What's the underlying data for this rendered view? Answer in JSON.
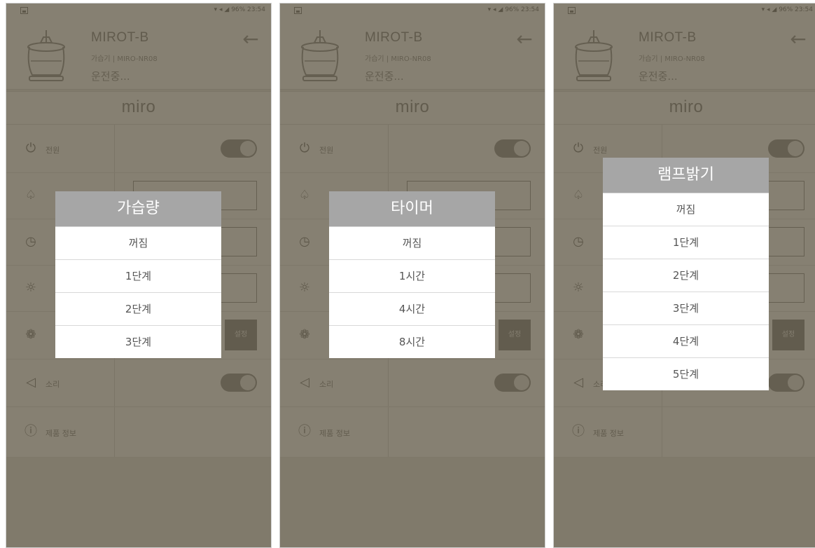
{
  "screens": [
    {
      "device": {
        "name": "MIROT-B",
        "model": "가습기 | MIRO-NR08",
        "status": "운전중..."
      },
      "dialog": {
        "title": "가습량",
        "options": [
          "꺼짐",
          "1단계",
          "2단계",
          "3단계"
        ]
      }
    },
    {
      "device": {
        "name": "MIROT-B",
        "model": "가습기 | MIRO-NR08",
        "status": "운전중..."
      },
      "dialog": {
        "title": "타이머",
        "options": [
          "꺼짐",
          "1시간",
          "4시간",
          "8시간"
        ]
      }
    },
    {
      "device": {
        "name": "MIROT-B",
        "model": "가습기 | MIRO-NR08",
        "status": "운전중..."
      },
      "dialog": {
        "title": "램프밝기",
        "options": [
          "꺼짐",
          "1단계",
          "2단계",
          "3단계",
          "4단계",
          "5단계"
        ]
      }
    }
  ],
  "status_bar": "96% 23:54",
  "brand": "miro",
  "controls": {
    "power_label": "전원",
    "sound_label": "소리",
    "info_label": "제품 정보",
    "set_label": "설정"
  },
  "colors": {
    "overlay": "#605846",
    "dialog_title_bg": "#a6a6a6"
  }
}
